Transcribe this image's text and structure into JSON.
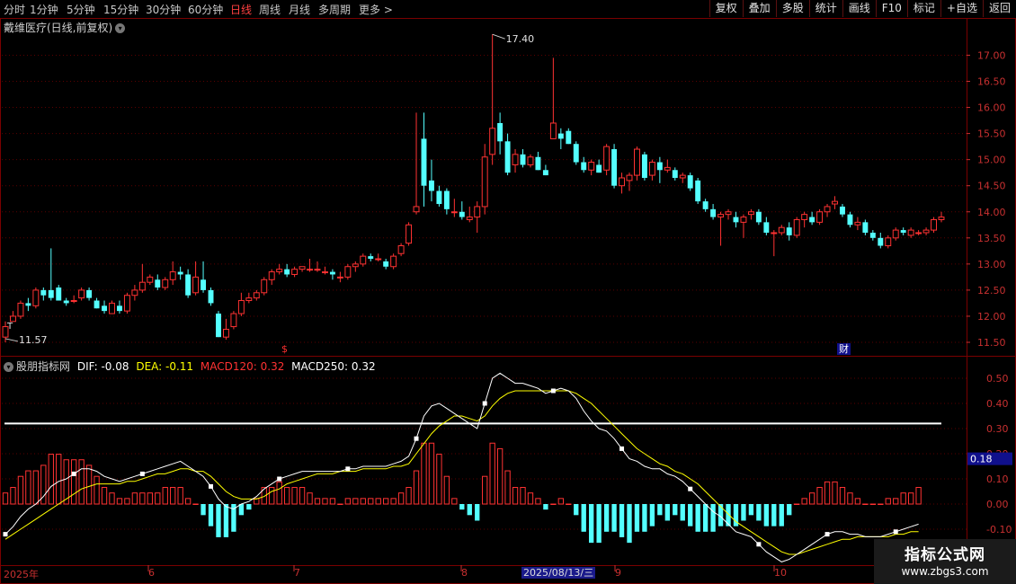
{
  "toolbar": {
    "periods": [
      "分时",
      "1分钟",
      "5分钟",
      "15分钟",
      "30分钟",
      "60分钟",
      "日线",
      "周线",
      "月线",
      "多周期",
      "更多 >"
    ],
    "active_period": "日线",
    "right_buttons": [
      "复权",
      "叠加",
      "多股",
      "统计",
      "画线",
      "F10",
      "标记",
      "+自选",
      "返回"
    ]
  },
  "main_chart": {
    "title": "戴维医疗(日线,前复权)",
    "high_label": "17.40",
    "low_label": "11.57",
    "y_ticks": [
      "17.00",
      "16.50",
      "16.00",
      "15.50",
      "15.00",
      "14.50",
      "14.00",
      "13.50",
      "13.00",
      "12.50",
      "12.00",
      "11.50"
    ],
    "markers": {
      "dollar": "$",
      "cai": "财",
      "t": "T"
    }
  },
  "indicator": {
    "name": "股朋指标网",
    "dif": "DIF: -0.08",
    "dea": "DEA: -0.11",
    "macd120": "MACD120: 0.32",
    "macd250": "MACD250: 0.32",
    "y_ticks": [
      "0.50",
      "0.40",
      "0.30",
      "0.20",
      "0.10",
      "0.00",
      "-0.10"
    ],
    "current_value": "0.18"
  },
  "x_axis": {
    "labels": [
      "2025年",
      "6",
      "7",
      "8",
      "9",
      "10"
    ],
    "highlight_date": "2025/08/13/三"
  },
  "watermark": {
    "line1": "指标公式网",
    "line2": "www.zbgs3.com"
  },
  "colors": {
    "up": "#ff3232",
    "down": "#54ffff",
    "grid": "#5a0000",
    "dif": "#ffffff",
    "dea": "#ffff00"
  },
  "chart_data": {
    "type": "candlestick",
    "x_labels": [
      "2025年",
      "6",
      "7",
      "8",
      "9",
      "10"
    ],
    "price_range": [
      11.4,
      17.5
    ],
    "candles": [
      [
        11.6,
        11.9,
        11.5,
        11.8
      ],
      [
        11.9,
        12.1,
        11.9,
        12.0
      ],
      [
        12.0,
        12.3,
        11.95,
        12.25
      ],
      [
        12.25,
        12.35,
        12.1,
        12.2
      ],
      [
        12.2,
        12.55,
        12.15,
        12.5
      ],
      [
        12.5,
        12.55,
        12.3,
        12.4
      ],
      [
        12.5,
        13.3,
        12.3,
        12.35
      ],
      [
        12.55,
        12.6,
        12.3,
        12.3
      ],
      [
        12.3,
        12.35,
        12.2,
        12.25
      ],
      [
        12.3,
        12.4,
        12.25,
        12.3
      ],
      [
        12.35,
        12.55,
        12.3,
        12.5
      ],
      [
        12.5,
        12.55,
        12.3,
        12.35
      ],
      [
        12.3,
        12.35,
        12.15,
        12.15
      ],
      [
        12.2,
        12.3,
        12.05,
        12.1
      ],
      [
        12.05,
        12.3,
        12.05,
        12.25
      ],
      [
        12.2,
        12.3,
        12.05,
        12.1
      ],
      [
        12.1,
        12.45,
        12.05,
        12.4
      ],
      [
        12.4,
        12.6,
        12.3,
        12.5
      ],
      [
        12.5,
        13.0,
        12.45,
        12.65
      ],
      [
        12.65,
        12.8,
        12.6,
        12.75
      ],
      [
        12.7,
        12.8,
        12.5,
        12.55
      ],
      [
        12.55,
        12.75,
        12.5,
        12.7
      ],
      [
        12.7,
        13.05,
        12.6,
        12.85
      ],
      [
        12.85,
        12.95,
        12.7,
        12.8
      ],
      [
        12.8,
        12.9,
        12.35,
        12.4
      ],
      [
        12.45,
        13.05,
        12.4,
        12.75
      ],
      [
        12.7,
        13.05,
        12.45,
        12.5
      ],
      [
        12.5,
        12.55,
        12.2,
        12.25
      ],
      [
        12.05,
        12.1,
        11.6,
        11.6
      ],
      [
        11.6,
        11.95,
        11.55,
        11.75
      ],
      [
        11.8,
        12.1,
        11.75,
        12.05
      ],
      [
        12.05,
        12.45,
        12.0,
        12.3
      ],
      [
        12.3,
        12.45,
        12.25,
        12.35
      ],
      [
        12.35,
        12.5,
        12.3,
        12.45
      ],
      [
        12.45,
        12.75,
        12.4,
        12.7
      ],
      [
        12.7,
        12.9,
        12.6,
        12.85
      ],
      [
        12.85,
        13.0,
        12.8,
        12.9
      ],
      [
        12.9,
        13.0,
        12.75,
        12.8
      ],
      [
        12.8,
        12.95,
        12.75,
        12.9
      ],
      [
        12.9,
        12.95,
        12.85,
        12.95
      ],
      [
        12.9,
        13.1,
        12.85,
        12.9
      ],
      [
        12.9,
        13.05,
        12.85,
        12.9
      ],
      [
        12.85,
        12.95,
        12.8,
        12.85
      ],
      [
        12.85,
        12.9,
        12.7,
        12.8
      ],
      [
        12.75,
        12.85,
        12.65,
        12.75
      ],
      [
        12.75,
        13.0,
        12.7,
        12.95
      ],
      [
        12.95,
        13.05,
        12.85,
        13.0
      ],
      [
        13.0,
        13.2,
        12.95,
        13.15
      ],
      [
        13.15,
        13.2,
        13.05,
        13.1
      ],
      [
        13.1,
        13.2,
        13.05,
        13.1
      ],
      [
        13.05,
        13.1,
        12.9,
        12.95
      ],
      [
        12.95,
        13.2,
        12.9,
        13.15
      ],
      [
        13.2,
        13.4,
        13.15,
        13.35
      ],
      [
        13.4,
        13.8,
        13.35,
        13.75
      ],
      [
        14.0,
        15.9,
        13.95,
        14.1
      ],
      [
        15.4,
        15.9,
        14.1,
        14.5
      ],
      [
        14.6,
        15.0,
        14.2,
        14.4
      ],
      [
        14.4,
        14.5,
        14.1,
        14.15
      ],
      [
        14.4,
        14.45,
        13.95,
        14.05
      ],
      [
        14.0,
        14.25,
        13.9,
        14.0
      ],
      [
        14.0,
        14.2,
        13.85,
        13.9
      ],
      [
        13.85,
        14.1,
        13.8,
        13.9
      ],
      [
        13.9,
        14.2,
        13.6,
        14.1
      ],
      [
        14.1,
        15.3,
        13.95,
        15.05
      ],
      [
        15.1,
        17.4,
        14.9,
        15.6
      ],
      [
        15.7,
        15.9,
        15.1,
        15.35
      ],
      [
        15.35,
        15.5,
        14.7,
        14.75
      ],
      [
        14.9,
        15.2,
        14.75,
        15.1
      ],
      [
        15.1,
        15.2,
        14.85,
        14.9
      ],
      [
        14.9,
        15.1,
        14.85,
        15.05
      ],
      [
        15.05,
        15.15,
        14.8,
        14.8
      ],
      [
        14.8,
        14.9,
        14.7,
        14.7
      ],
      [
        15.4,
        16.95,
        15.4,
        15.7
      ],
      [
        15.5,
        15.6,
        15.2,
        15.4
      ],
      [
        15.55,
        15.6,
        15.3,
        15.3
      ],
      [
        15.3,
        15.35,
        14.9,
        14.95
      ],
      [
        14.95,
        15.05,
        14.75,
        14.8
      ],
      [
        14.8,
        15.0,
        14.7,
        14.95
      ],
      [
        14.9,
        15.0,
        14.75,
        14.75
      ],
      [
        14.8,
        15.3,
        14.7,
        15.25
      ],
      [
        15.2,
        15.3,
        14.45,
        14.5
      ],
      [
        14.5,
        14.75,
        14.35,
        14.65
      ],
      [
        14.6,
        14.75,
        14.4,
        14.7
      ],
      [
        14.7,
        15.25,
        14.6,
        15.2
      ],
      [
        15.1,
        15.15,
        14.6,
        14.65
      ],
      [
        14.7,
        15.0,
        14.6,
        14.95
      ],
      [
        14.95,
        15.05,
        14.55,
        14.8
      ],
      [
        14.8,
        15.0,
        14.75,
        14.85
      ],
      [
        14.8,
        14.85,
        14.6,
        14.65
      ],
      [
        14.65,
        14.75,
        14.55,
        14.7
      ],
      [
        14.7,
        14.75,
        14.4,
        14.45
      ],
      [
        14.6,
        14.65,
        14.15,
        14.2
      ],
      [
        14.2,
        14.25,
        14.0,
        14.05
      ],
      [
        14.05,
        14.15,
        13.85,
        13.9
      ],
      [
        13.9,
        14.0,
        13.35,
        13.95
      ],
      [
        13.95,
        14.05,
        13.85,
        14.0
      ],
      [
        13.9,
        14.0,
        13.7,
        13.8
      ],
      [
        13.8,
        13.95,
        13.5,
        13.9
      ],
      [
        13.95,
        14.05,
        13.85,
        14.0
      ],
      [
        14.0,
        14.05,
        13.75,
        13.8
      ],
      [
        13.8,
        13.9,
        13.55,
        13.6
      ],
      [
        13.6,
        13.65,
        13.15,
        13.6
      ],
      [
        13.6,
        13.75,
        13.55,
        13.7
      ],
      [
        13.7,
        13.8,
        13.45,
        13.55
      ],
      [
        13.55,
        13.9,
        13.5,
        13.85
      ],
      [
        13.85,
        14.0,
        13.7,
        13.95
      ],
      [
        13.9,
        14.0,
        13.75,
        13.8
      ],
      [
        13.8,
        14.05,
        13.75,
        14.0
      ],
      [
        14.0,
        14.15,
        13.9,
        14.1
      ],
      [
        14.15,
        14.3,
        14.05,
        14.2
      ],
      [
        14.1,
        14.15,
        13.9,
        13.95
      ],
      [
        13.95,
        14.0,
        13.7,
        13.75
      ],
      [
        13.75,
        13.9,
        13.65,
        13.8
      ],
      [
        13.8,
        13.85,
        13.55,
        13.6
      ],
      [
        13.6,
        13.65,
        13.45,
        13.5
      ],
      [
        13.5,
        13.6,
        13.3,
        13.35
      ],
      [
        13.35,
        13.55,
        13.3,
        13.5
      ],
      [
        13.5,
        13.7,
        13.45,
        13.65
      ],
      [
        13.65,
        13.7,
        13.55,
        13.6
      ],
      [
        13.55,
        13.7,
        13.5,
        13.65
      ],
      [
        13.6,
        13.65,
        13.55,
        13.6
      ],
      [
        13.6,
        13.7,
        13.55,
        13.65
      ],
      [
        13.65,
        13.9,
        13.6,
        13.85
      ],
      [
        13.85,
        14.0,
        13.8,
        13.9
      ]
    ],
    "dif": [
      -0.12,
      -0.09,
      -0.05,
      -0.02,
      0.0,
      0.03,
      0.07,
      0.09,
      0.1,
      0.12,
      0.14,
      0.14,
      0.13,
      0.11,
      0.1,
      0.09,
      0.1,
      0.11,
      0.12,
      0.13,
      0.14,
      0.15,
      0.16,
      0.17,
      0.15,
      0.13,
      0.11,
      0.07,
      0.02,
      -0.01,
      -0.02,
      0.0,
      0.01,
      0.03,
      0.06,
      0.08,
      0.1,
      0.11,
      0.12,
      0.13,
      0.13,
      0.13,
      0.13,
      0.13,
      0.13,
      0.14,
      0.14,
      0.15,
      0.15,
      0.15,
      0.15,
      0.16,
      0.17,
      0.19,
      0.26,
      0.35,
      0.39,
      0.4,
      0.38,
      0.36,
      0.34,
      0.32,
      0.3,
      0.4,
      0.5,
      0.52,
      0.5,
      0.48,
      0.48,
      0.47,
      0.46,
      0.44,
      0.45,
      0.46,
      0.45,
      0.42,
      0.37,
      0.33,
      0.3,
      0.29,
      0.26,
      0.22,
      0.18,
      0.17,
      0.15,
      0.14,
      0.14,
      0.12,
      0.11,
      0.09,
      0.06,
      0.03,
      0.0,
      -0.03,
      -0.05,
      -0.08,
      -0.11,
      -0.12,
      -0.13,
      -0.16,
      -0.19,
      -0.21,
      -0.23,
      -0.22,
      -0.2,
      -0.18,
      -0.16,
      -0.14,
      -0.12,
      -0.11,
      -0.11,
      -0.12,
      -0.12,
      -0.13,
      -0.13,
      -0.13,
      -0.12,
      -0.11,
      -0.1,
      -0.09,
      -0.08
    ],
    "dea": [
      -0.14,
      -0.12,
      -0.1,
      -0.08,
      -0.06,
      -0.04,
      -0.02,
      0.0,
      0.02,
      0.04,
      0.06,
      0.07,
      0.08,
      0.08,
      0.08,
      0.08,
      0.09,
      0.09,
      0.1,
      0.11,
      0.12,
      0.12,
      0.13,
      0.14,
      0.14,
      0.13,
      0.13,
      0.11,
      0.08,
      0.05,
      0.03,
      0.02,
      0.02,
      0.02,
      0.03,
      0.05,
      0.06,
      0.08,
      0.09,
      0.1,
      0.11,
      0.12,
      0.12,
      0.12,
      0.13,
      0.13,
      0.13,
      0.14,
      0.14,
      0.14,
      0.14,
      0.15,
      0.15,
      0.16,
      0.2,
      0.24,
      0.28,
      0.31,
      0.33,
      0.35,
      0.35,
      0.34,
      0.33,
      0.35,
      0.39,
      0.42,
      0.44,
      0.45,
      0.45,
      0.45,
      0.45,
      0.45,
      0.45,
      0.45,
      0.45,
      0.44,
      0.42,
      0.4,
      0.37,
      0.34,
      0.31,
      0.28,
      0.25,
      0.22,
      0.2,
      0.18,
      0.16,
      0.15,
      0.13,
      0.12,
      0.1,
      0.08,
      0.05,
      0.02,
      -0.01,
      -0.04,
      -0.07,
      -0.09,
      -0.11,
      -0.13,
      -0.15,
      -0.17,
      -0.19,
      -0.2,
      -0.2,
      -0.19,
      -0.18,
      -0.17,
      -0.16,
      -0.15,
      -0.14,
      -0.14,
      -0.13,
      -0.13,
      -0.13,
      -0.13,
      -0.13,
      -0.12,
      -0.12,
      -0.11,
      -0.11
    ],
    "reference_line": 0.32,
    "indicator_range": [
      -0.22,
      0.58
    ]
  }
}
